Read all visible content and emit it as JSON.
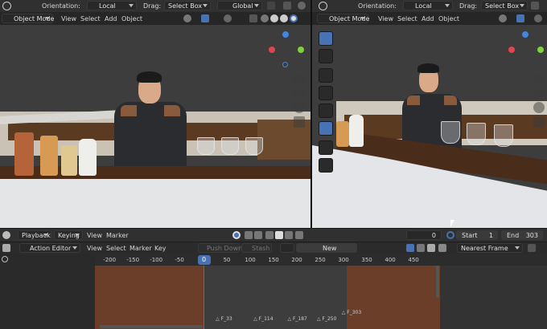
{
  "header_left": {
    "orientation_label": "Orientation:",
    "orientation_value": "Local",
    "drag_label": "Drag:",
    "drag_value": "Select Box",
    "transform_value": "Global"
  },
  "header_right": {
    "orientation_label": "Orientation:",
    "orientation_value": "Local",
    "drag_label": "Drag:",
    "drag_value": "Select Box"
  },
  "viewport_left_menu": {
    "mode": "Object Mode",
    "view": "View",
    "select": "Select",
    "add": "Add",
    "object": "Object"
  },
  "viewport_right_menu": {
    "mode": "Object Mode",
    "view": "View",
    "select": "Select",
    "add": "Add",
    "object": "Object"
  },
  "gizmo": {
    "x_color": "#e2444c",
    "y_color": "#7ed23a",
    "z_color": "#3f86e0"
  },
  "timeline_header": {
    "playback": "Playback",
    "keying": "Keying",
    "view": "View",
    "marker": "Marker",
    "current_frame": "0",
    "start_label": "Start",
    "start_value": "1",
    "end_label": "End",
    "end_value": "303"
  },
  "action_editor": {
    "editor_type": "Action Editor",
    "view": "View",
    "select": "Select",
    "marker": "Marker",
    "key": "Key",
    "push_down": "Push Down",
    "stash": "Stash",
    "new": "New",
    "snap": "Nearest Frame"
  },
  "ruler": {
    "ticks": [
      "-200",
      "-150",
      "-100",
      "-50",
      "0",
      "50",
      "100",
      "150",
      "200",
      "250",
      "300",
      "350",
      "400",
      "450"
    ],
    "current": "0"
  },
  "markers": [
    "F_33",
    "F_114",
    "F_187",
    "F_250",
    "F_303"
  ],
  "colors": {
    "accent": "#4772b3",
    "range_out": "#6b3e2a",
    "range_in": "#3a3a3a"
  }
}
